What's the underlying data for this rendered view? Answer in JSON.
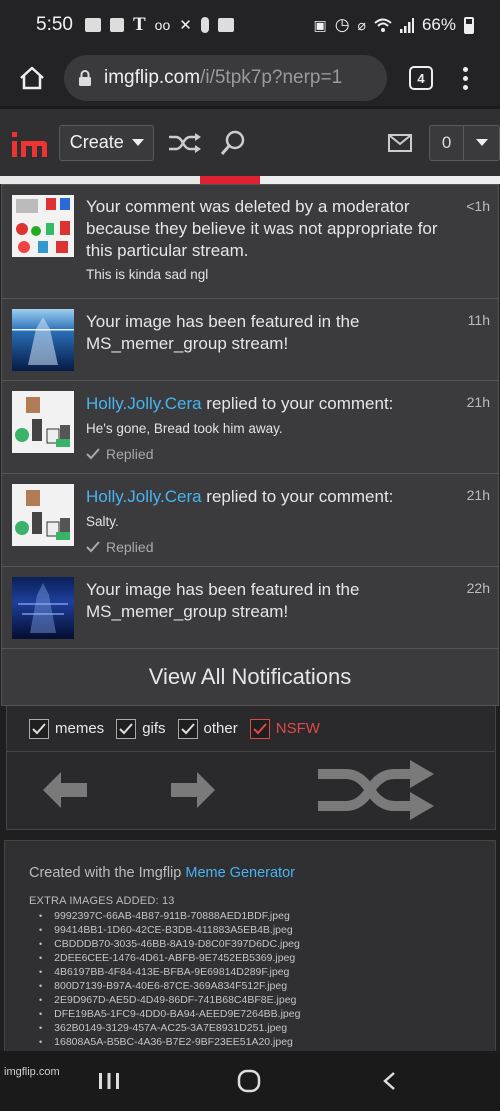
{
  "status_bar": {
    "time": "5:50",
    "battery": "66%"
  },
  "browser": {
    "url_host": "imgflip.com",
    "url_path": "/i/5tpk7p?nerp=1",
    "tab_count": "4"
  },
  "site_header": {
    "create_label": "Create",
    "notification_count": "0"
  },
  "notifications": {
    "items": [
      {
        "text": "Your comment was deleted by a moderator because they believe it was not appropriate for this particular stream.",
        "sub": "This is kinda sad ngl",
        "time": "<1h"
      },
      {
        "text": "Your image has been featured in the MS_memer_group stream!",
        "time": "11h"
      },
      {
        "user": "Holly.Jolly.Cera",
        "action": " replied to your comment:",
        "sub": "He's gone, Bread took him away.",
        "status": "Replied",
        "time": "21h"
      },
      {
        "user": "Holly.Jolly.Cera",
        "action": " replied to your comment:",
        "sub": "Salty.",
        "status": "Replied",
        "time": "21h"
      },
      {
        "text": "Your image has been featured in the MS_memer_group stream!",
        "time": "22h"
      }
    ],
    "view_all": "View All Notifications"
  },
  "filters": [
    {
      "label": "memes",
      "checked": true
    },
    {
      "label": "gifs",
      "checked": true
    },
    {
      "label": "other",
      "checked": true
    },
    {
      "label": "NSFW",
      "checked": true
    }
  ],
  "info": {
    "created_prefix": "Created with the Imgflip ",
    "created_link": "Meme Generator",
    "extra_heading": "EXTRA IMAGES ADDED: 13",
    "extra_images": [
      "9992397C-66AB-4B87-911B-70888AED1BDF.jpeg",
      "99414BB1-1D60-42CE-B3DB-411883A5EB4B.jpeg",
      "CBDDDB70-3035-46BB-8A19-D8C0F397D6DC.jpeg",
      "2DEE6CEE-1476-4D61-ABFB-9E7452EB5369.jpeg",
      "4B6197BB-4F84-413E-BFBA-9E69814D289F.jpeg",
      "800D7139-B97A-40E6-87CE-369A834F512F.jpeg",
      "2E9D967D-AE5D-4D49-86DF-741B68C4BF8E.jpeg",
      "DFE19BA5-1FC9-4DD0-BA94-AEED9E7264BB.jpeg",
      "362B0149-3129-457A-AC25-3A7E8931D251.jpeg",
      "16808A5A-B5BC-4A36-B7E2-9BF23EE51A20.jpeg"
    ]
  },
  "watermark": "imgflip.com"
}
